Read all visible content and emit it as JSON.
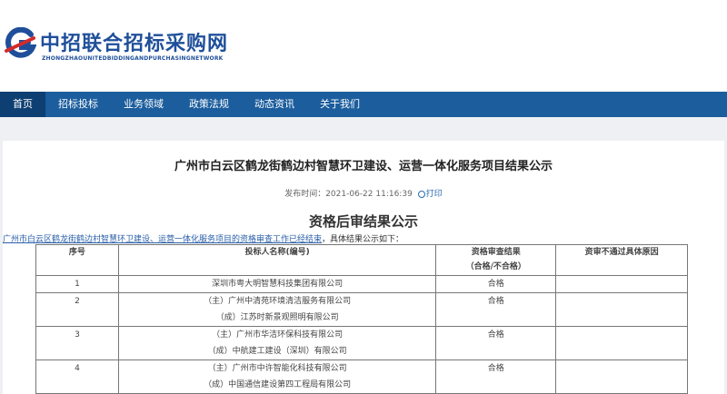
{
  "site": {
    "title": "中招联合招标采购网",
    "subtitle": "ZHONGZHAOUNITEDBIDDINGANDPURCHASINGNETWORK",
    "logo_color": "#1f4f9a",
    "logo_accent": "#d42b2b"
  },
  "nav": {
    "items": [
      "首页",
      "招标投标",
      "业务领域",
      "政策法规",
      "动态资讯",
      "关于我们"
    ],
    "active_index": 0,
    "bg_color": "#1b5d9d"
  },
  "article": {
    "title": "广州市白云区鹤龙街鹤边村智慧环卫建设、运营一体化服务项目结果公示",
    "publish_label": "发布时间：",
    "publish_time": "2021-06-22 11:16:39",
    "print_label": "打印",
    "section_title": "资格后审结果公示",
    "intro_link": "广州市白云区鹤龙街鹤边村智慧环卫建设、运营一体化服务项目的资格审查工作已经结束",
    "intro_tail": "，具体结果公示如下："
  },
  "table": {
    "headers": {
      "no": "序号",
      "name": "投标人名称(编号)",
      "result_1": "资格审查结果",
      "result_2": "（合格/不合格）",
      "reason": "资审不通过具体原因"
    },
    "rows": [
      {
        "no": "1",
        "line1": "深圳市粤大明智慧科技集团有限公司",
        "line2": "",
        "result": "合格",
        "reason": ""
      },
      {
        "no": "2",
        "line1": "（主）广州中清苑环境清洁服务有限公司",
        "line2": "（成）江苏时新景观照明有限公司",
        "result": "合格",
        "reason": ""
      },
      {
        "no": "3",
        "line1": "（主）广州市华洁环保科技有限公司",
        "line2": "（成）中航建工建设（深圳）有限公司",
        "result": "合格",
        "reason": ""
      },
      {
        "no": "4",
        "line1": "（主）广州市中许智能化科技有限公司",
        "line2": "（成）中国通信建设第四工程局有限公司",
        "result": "合格",
        "reason": ""
      }
    ]
  }
}
